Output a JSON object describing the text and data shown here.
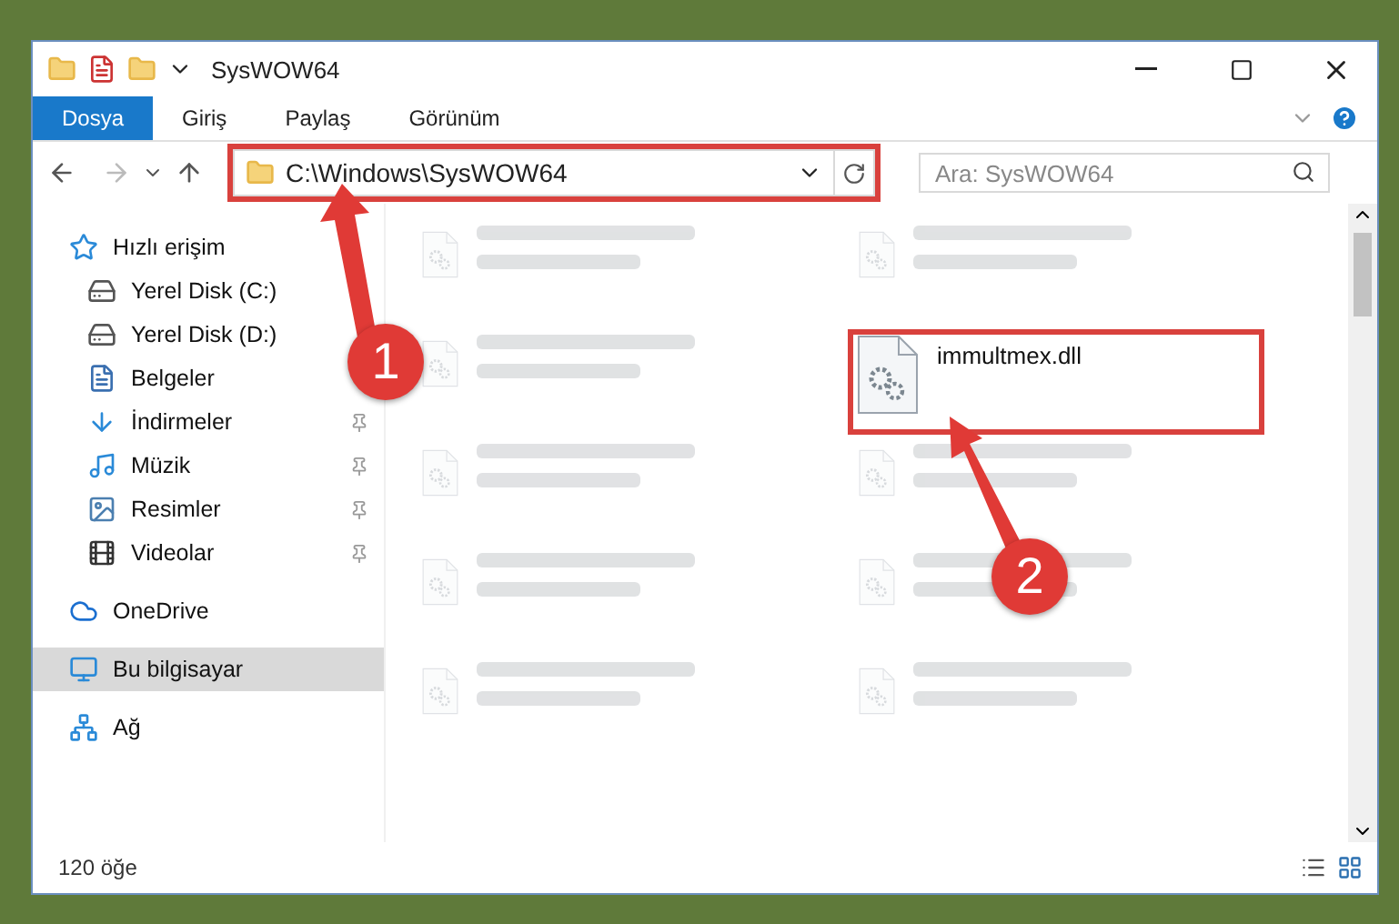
{
  "window": {
    "title": "SysWOW64"
  },
  "ribbon_tabs": [
    {
      "label": "Dosya",
      "selected": true
    },
    {
      "label": "Giriş",
      "selected": false
    },
    {
      "label": "Paylaş",
      "selected": false
    },
    {
      "label": "Görünüm",
      "selected": false
    }
  ],
  "address": {
    "path": "C:\\Windows\\SysWOW64",
    "highlighted": true
  },
  "search": {
    "placeholder": "Ara: SysWOW64"
  },
  "sidebar": {
    "items": [
      {
        "label": "Hızlı erişim",
        "kind": "star",
        "selected": false,
        "children": [
          {
            "label": "Yerel Disk (C:)",
            "kind": "drive",
            "pinned": false,
            "selected": false
          },
          {
            "label": "Yerel Disk (D:)",
            "kind": "drive",
            "pinned": false,
            "selected": false
          },
          {
            "label": "Belgeler",
            "kind": "documents",
            "pinned": false,
            "selected": false
          },
          {
            "label": "İndirmeler",
            "kind": "downloads",
            "pinned": true,
            "selected": false
          },
          {
            "label": "Müzik",
            "kind": "music",
            "pinned": true,
            "selected": false
          },
          {
            "label": "Resimler",
            "kind": "pictures",
            "pinned": true,
            "selected": false
          },
          {
            "label": "Videolar",
            "kind": "videos",
            "pinned": true,
            "selected": false
          }
        ]
      },
      {
        "label": "OneDrive",
        "kind": "cloud",
        "selected": false
      },
      {
        "label": "Bu bilgisayar",
        "kind": "computer",
        "selected": true
      },
      {
        "label": "Ağ",
        "kind": "network",
        "selected": false
      }
    ]
  },
  "files": [
    {
      "blurred": true
    },
    {
      "blurred": true
    },
    {
      "blurred": true
    },
    {
      "name": "immultmex.dll",
      "blurred": false,
      "highlighted": true
    },
    {
      "blurred": true
    },
    {
      "blurred": true
    },
    {
      "blurred": true
    },
    {
      "blurred": true
    },
    {
      "blurred": true
    },
    {
      "blurred": true
    }
  ],
  "status_bar": {
    "count": "120 öğe"
  },
  "annotations": [
    {
      "label": "1"
    },
    {
      "label": "2"
    }
  ]
}
